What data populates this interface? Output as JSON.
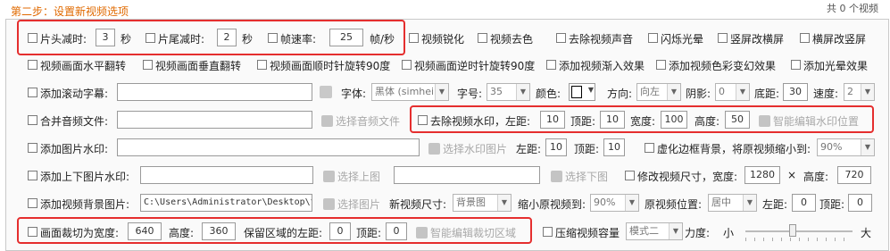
{
  "step_title": "第二步：设置新视频选项",
  "video_count": "共 0 个视频",
  "row1": {
    "head_cut_label": "片头减时:",
    "head_cut_value": "3",
    "head_cut_unit": "秒",
    "tail_cut_label": "片尾减时:",
    "tail_cut_value": "2",
    "tail_cut_unit": "秒",
    "fps_label": "帧速率:",
    "fps_value": "25",
    "fps_unit": "帧/秒",
    "sharpen": "视频锐化",
    "decolor": "视频去色",
    "remove_audio": "去除视频声音",
    "flash": "闪烁光晕",
    "v2h": "竖屏改横屏",
    "h2v": "横屏改竖屏"
  },
  "row2": {
    "hflip": "视频画面水平翻转",
    "vflip": "视频画面垂直翻转",
    "rot_cw": "视频画面顺时针旋转90度",
    "rot_ccw": "视频画面逆时针旋转90度",
    "fade_in": "添加视频渐入效果",
    "color_fx": "添加视频色彩变幻效果",
    "halo": "添加光晕效果"
  },
  "row3": {
    "scroll_sub": "添加滚动字幕:",
    "font_label": "字体:",
    "font_value": "黑体 (simhei)",
    "size_label": "字号:",
    "size_value": "35",
    "color_label": "颜色:",
    "dir_label": "方向:",
    "dir_value": "向左",
    "shadow_label": "阴影:",
    "shadow_value": "0",
    "bottom_label": "底距:",
    "bottom_value": "30",
    "speed_label": "速度:",
    "speed_value": "2"
  },
  "row4": {
    "merge_audio": "合并音频文件:",
    "choose_audio": "选择音频文件",
    "remove_wm": "去除视频水印，左距:",
    "left_value": "10",
    "top_label": "顶距:",
    "top_value": "10",
    "width_label": "宽度:",
    "width_value": "100",
    "height_label": "高度:",
    "height_value": "50",
    "smart_wm": "智能编辑水印位置"
  },
  "row5": {
    "img_wm": "添加图片水印:",
    "choose_wm_img": "选择水印图片",
    "left_label": "左距:",
    "left_value": "10",
    "top_label": "顶距:",
    "top_value": "10",
    "blur_bg": "虚化边框背景，将原视频缩小到:",
    "scale_value": "90%"
  },
  "row6": {
    "tb_img_wm": "添加上下图片水印:",
    "choose_top": "选择上图",
    "choose_bottom": "选择下图",
    "resize": "修改视频尺寸，宽度:",
    "width_value": "1280",
    "times": "×",
    "height_label": "高度:",
    "height_value": "720"
  },
  "row7": {
    "bg_img": "添加视频背景图片:",
    "bg_path": "C:\\Users\\Administrator\\Desktop\\t",
    "choose_img": "选择图片",
    "new_size_label": "新视频尺寸:",
    "new_size_value": "背景图",
    "shrink_label": "缩小原视频到:",
    "shrink_value": "90%",
    "pos_label": "原视频位置:",
    "pos_value": "居中",
    "left_label": "左距:",
    "left_value": "0",
    "top_label": "顶距:",
    "top_value": "0"
  },
  "row8": {
    "crop_label": "画面裁切为宽度:",
    "crop_width": "640",
    "height_label": "高度:",
    "crop_height": "360",
    "keep_left_label": "保留区域的左距:",
    "keep_left": "0",
    "top_label": "顶距:",
    "keep_top": "0",
    "smart_crop": "智能编辑裁切区域",
    "compress": "压缩视频容量",
    "mode_value": "模式二",
    "strength_label": "力度:",
    "small": "小",
    "large": "大",
    "strength_fraction": 0.44
  },
  "colors": {
    "accent": "#e06a00",
    "highlight": "#e52e2e"
  }
}
